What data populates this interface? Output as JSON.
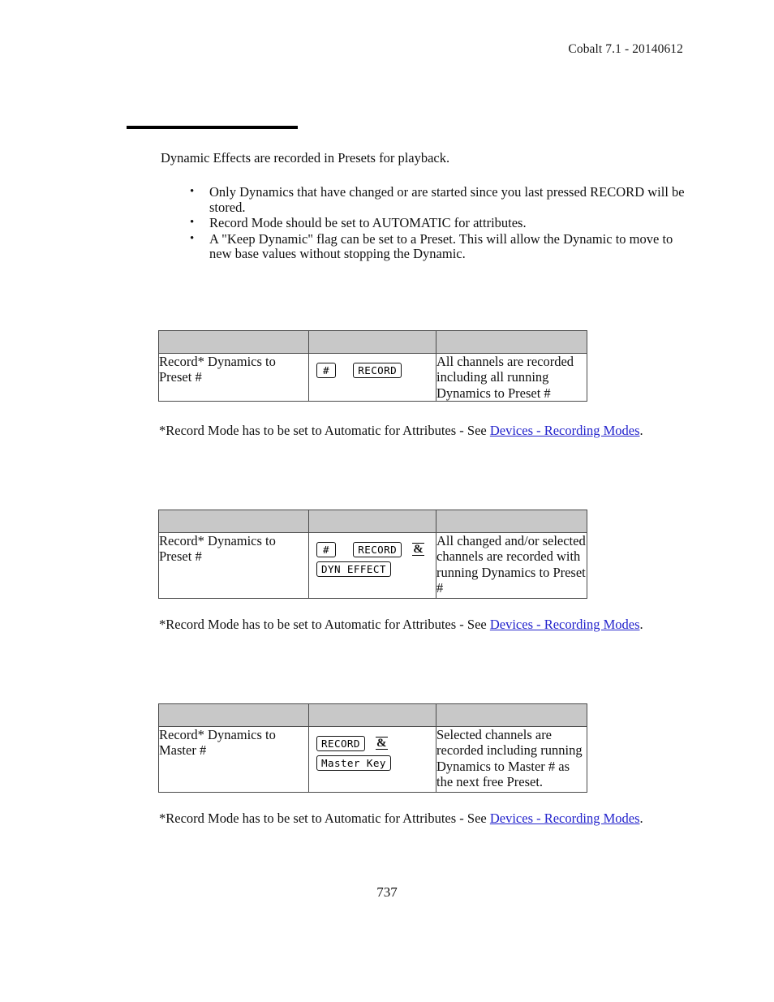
{
  "header": {
    "running_head": "Cobalt 7.1 - 20140612"
  },
  "intro": {
    "paragraph": "Dynamic Effects are recorded in Presets for playback."
  },
  "bullets": {
    "marker": "•",
    "items": [
      "Only Dynamics that have changed or are started since you last pressed RECORD will be stored.",
      "Record Mode should be set to AUTOMATIC for attributes.",
      "A \"Keep Dynamic\" flag can be set to a Preset. This will allow the Dynamic to move to new base values without stopping the Dynamic."
    ]
  },
  "tables": [
    {
      "action": "Record* Dynamics to Preset #",
      "keys_line1": [
        "#",
        "RECORD"
      ],
      "keys_line1_amp": "",
      "keys_line2": [],
      "result": "All channels are recorded including all running Dynamics to Preset #"
    },
    {
      "action": "Record* Dynamics to Preset #",
      "keys_line1": [
        "#",
        "RECORD"
      ],
      "keys_line1_amp": "&",
      "keys_line2": [
        "DYN EFFECT"
      ],
      "result": "All changed and/or selected channels are recorded with running Dynamics to Preset #"
    },
    {
      "action": "Record* Dynamics to Master #",
      "keys_line1": [
        "RECORD"
      ],
      "keys_line1_amp": "&",
      "keys_line2": [
        "Master Key"
      ],
      "result": "Selected channels are recorded including running Dynamics to Master # as the next free Preset."
    }
  ],
  "footnotes": {
    "prefix": "*Record Mode has to be set to Automatic for Attributes - See ",
    "link_text": "Devices - Recording Modes",
    "suffix": "."
  },
  "footer": {
    "page_number": "737"
  },
  "colors": {
    "table_header_gray": "#c8c8c8",
    "link_blue": "#2222cc",
    "rule_black": "#000000"
  }
}
